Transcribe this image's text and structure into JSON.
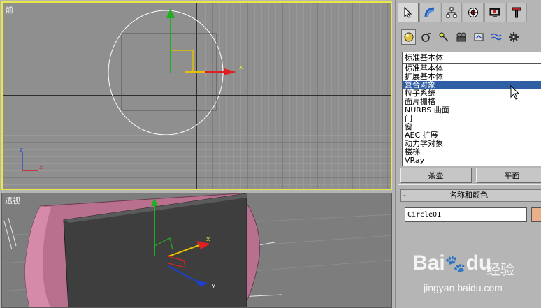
{
  "viewports": {
    "front_label": "前",
    "persp_label": "透视",
    "axis_x": "x",
    "axis_y": "y",
    "axis_z": "z"
  },
  "panel": {
    "tabs": [
      "create",
      "modify",
      "hierarchy",
      "motion",
      "display",
      "utilities"
    ],
    "subtabs": [
      "geometry",
      "shapes",
      "lights",
      "cameras",
      "helpers",
      "space-warps",
      "systems"
    ],
    "category_select": "标准基本体",
    "category_options": [
      "标准基本体",
      "扩展基本体",
      "复合对象",
      "粒子系统",
      "面片栅格",
      "NURBS 曲面",
      "门",
      "窗",
      "AEC 扩展",
      "动力学对象",
      "楼梯",
      "VRay"
    ],
    "selected_option_index": 2,
    "buttons": [
      "茶壶",
      "平面"
    ],
    "rollout_minus": "-",
    "rollout_title": "名称和颜色",
    "object_name": "Circle01",
    "object_color": "#e7b08a"
  },
  "watermark": {
    "brand": "Bai",
    "brand2": "du",
    "cn": "经验",
    "url": "jingyan.baidu.com"
  }
}
